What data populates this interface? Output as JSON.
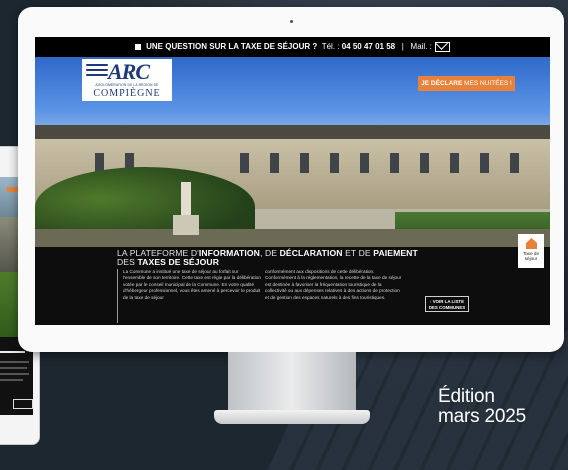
{
  "topbar": {
    "question": "UNE QUESTION SUR LA TAXE DE SÉJOUR ?",
    "tel_label": "Tél. :",
    "tel_number": "04 50 47 01 58",
    "separator": "|",
    "mail_label": "Mail. :"
  },
  "logo": {
    "name": "ARC",
    "subtitle": "AGGLOMÉRATION DE LA RÉGION DE",
    "city": "COMPIÈGNE"
  },
  "declare_button": {
    "strong": "JE DÉCLARE",
    "rest": "MES NUITÉES !"
  },
  "headline": {
    "part1": "La plateforme d'",
    "bold1": "information",
    "part2": ", de ",
    "bold2": "déclaration",
    "part3": " et de ",
    "bold3": "paiement",
    "part4": "des ",
    "bold4": "taxes de séjour"
  },
  "body": {
    "col1": "La Commune a institué une taxe de séjour au forfait sur l'ensemble de son territoire. Cette taxe est régie par la délibération votée par le conseil municipal de la Commune. En votre qualité d'hébergeur professionnel, vous êtes amené à percevoir le produit de la taxe de séjour",
    "col2": "conformément aux dispositions de cette délibération. Conformément à la réglementation, la recette de la taxe de séjour est destinée à favoriser la fréquentation touristique de la collectivité ou aux dépenses relatives à des actions de protection et de gestion des espaces naturels à des fins touristiques."
  },
  "list_button": {
    "arrow": "›",
    "line1": "VOIR LA LISTE",
    "line2": "DES COMMUNES"
  },
  "badge": {
    "line1": "Taxe de",
    "line2": "séjour"
  },
  "edition": {
    "line1": "Édition",
    "line2": "mars 2025"
  },
  "colors": {
    "accent": "#e8823a",
    "brand": "#1f3a7a"
  }
}
